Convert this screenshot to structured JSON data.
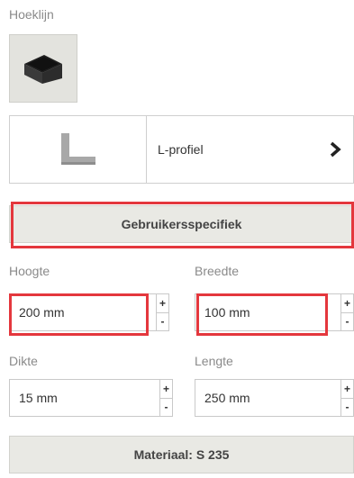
{
  "section": {
    "title": "Hoeklijn",
    "icon": "angle-profile-icon"
  },
  "profile": {
    "name": "L-profiel",
    "thumb_icon": "l-profile-icon",
    "arrow_icon": "chevron-right-icon"
  },
  "mode_button": {
    "label": "Gebruikersspecifiek"
  },
  "fields": {
    "hoogte": {
      "label": "Hoogte",
      "value": "200 mm"
    },
    "breedte": {
      "label": "Breedte",
      "value": "100 mm"
    },
    "dikte": {
      "label": "Dikte",
      "value": "15 mm"
    },
    "lengte": {
      "label": "Lengte",
      "value": "250 mm"
    }
  },
  "stepper": {
    "plus": "+",
    "minus": "-"
  },
  "material_button": {
    "label": "Materiaal: S 235"
  },
  "colors": {
    "highlight": "#e4373d",
    "tile_bg": "#e3e3de",
    "button_bg": "#e9e9e4"
  }
}
